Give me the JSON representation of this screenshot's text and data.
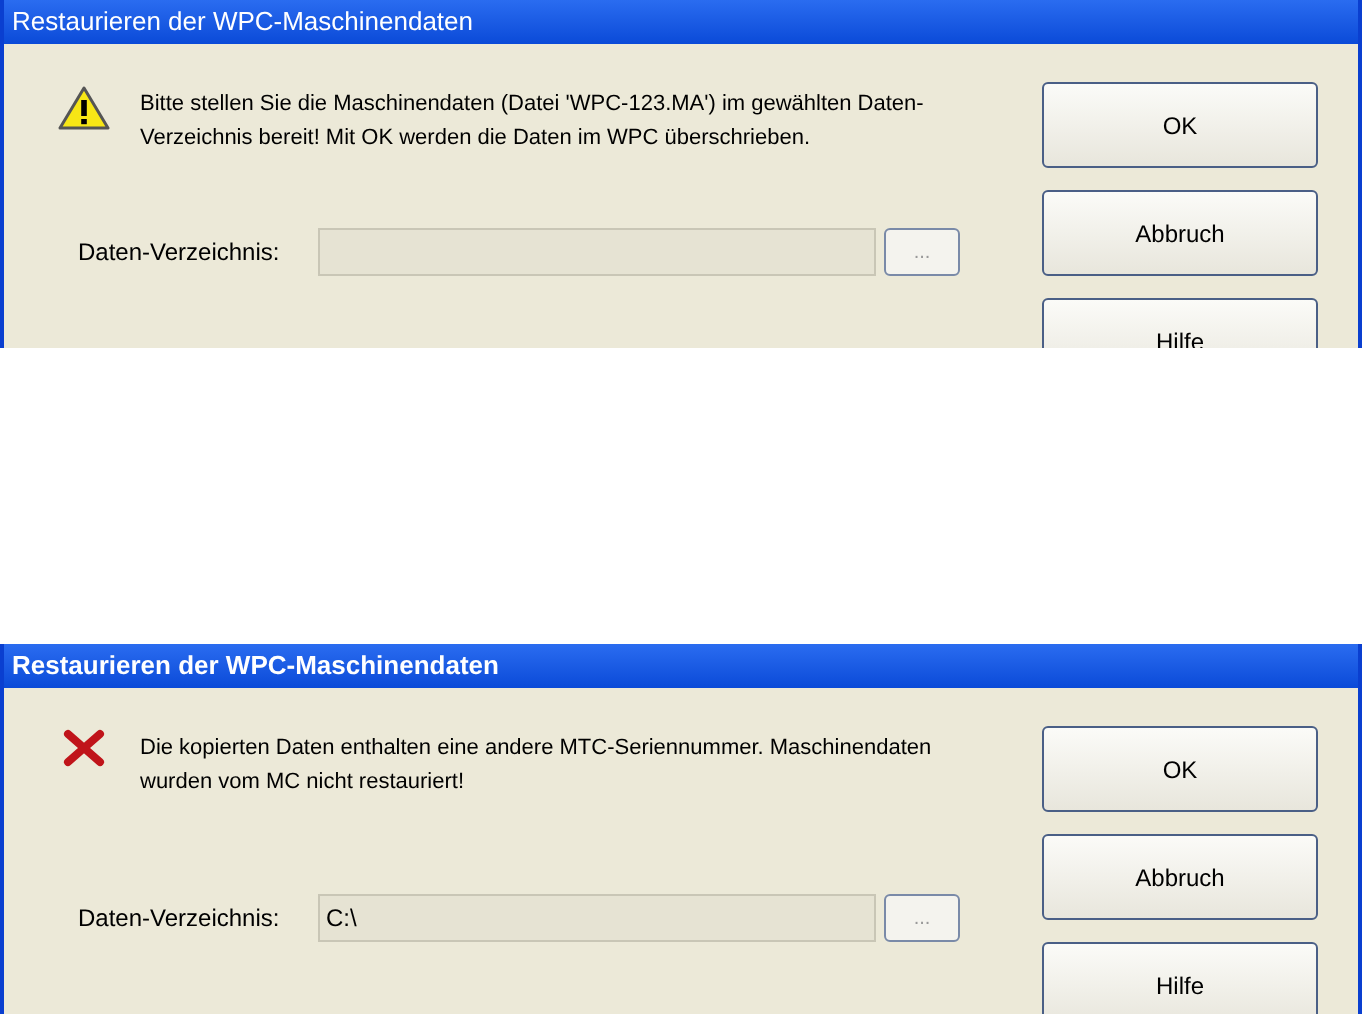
{
  "dialogs": [
    {
      "window": {
        "title": "Restaurieren der WPC-Maschinendaten"
      },
      "icon": {
        "kind": "warning"
      },
      "message": "Bitte stellen Sie die Maschinendaten (Datei 'WPC-123.MA') im gewählten Daten-Verzeichnis bereit! Mit OK werden die Daten im WPC überschrieben.",
      "field": {
        "label": "Daten-Verzeichnis:"
      },
      "browse_button": "...",
      "buttons": [
        "OK",
        "Abbruch",
        "Hilfe"
      ]
    },
    {
      "window": {
        "title": "Restaurieren der WPC-Maschinendaten"
      },
      "icon": {
        "kind": "error"
      },
      "message": "Die kopierten Daten enthalten eine andere MTC-Seriennummer. Maschinendaten wurden vom MC nicht restauriert!",
      "field": {
        "label": "Daten-Verzeichnis:",
        "value": "C:\\"
      },
      "browse_button": "...",
      "buttons": [
        "OK",
        "Abbruch",
        "Hilfe"
      ]
    }
  ]
}
